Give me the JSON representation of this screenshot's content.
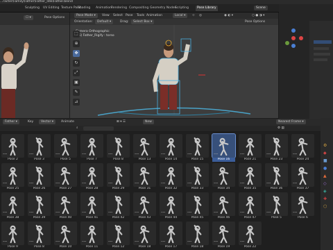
{
  "title": "...racter\\Family\\Father\\Father_Idle\\Father.blend",
  "menu_tabs": [
    {
      "label": "Sculpting",
      "active": false
    },
    {
      "label": "UV Editing",
      "active": false
    },
    {
      "label": "Texture Paint",
      "active": false
    },
    {
      "label": "Shading",
      "active": false
    },
    {
      "label": "Animation",
      "active": false
    },
    {
      "label": "Rendering",
      "active": false
    },
    {
      "label": "Compositing",
      "active": false
    },
    {
      "label": "Geometry Nodes",
      "active": false
    },
    {
      "label": "Scripting",
      "active": false
    },
    {
      "label": "Pose Library",
      "active": true
    }
  ],
  "topright": {
    "scene_label": "Scene",
    "layer_label": "Default"
  },
  "left_view": {
    "pose_options": "Pose Options"
  },
  "viewport": {
    "mode": "Pose Mode",
    "menus": [
      "View",
      "Select",
      "Pose",
      "Tools",
      "Animation"
    ],
    "orientation_label": "Orientation:",
    "orientation_value": "Default",
    "drag_label": "Drag:",
    "drag_value": "Select Box",
    "transform": "Local",
    "pose_options": "Pose Options",
    "camera_line1": "Camera Orthographic",
    "camera_line2": "(15) Father_Rigify : torso"
  },
  "asset_browser": {
    "library": "Father",
    "key_label": "Key",
    "mode": "Vector",
    "anim_label": "Animate",
    "new_label": "New",
    "nearest_frame": "Nearest Frame",
    "tabs": [
      "Select",
      "Mesh",
      "View",
      "Select"
    ]
  },
  "poses": [
    {
      "label": "Pose 2",
      "sel": false
    },
    {
      "label": "Pose 3",
      "sel": false
    },
    {
      "label": "Pose 5",
      "sel": false
    },
    {
      "label": "Pose 7",
      "sel": false
    },
    {
      "label": "Pose 8",
      "sel": false
    },
    {
      "label": "Pose 13",
      "sel": false
    },
    {
      "label": "Pose 14",
      "sel": false
    },
    {
      "label": "Pose 15",
      "sel": false
    },
    {
      "label": "Pose 16",
      "sel": true
    },
    {
      "label": "Pose 21",
      "sel": false
    },
    {
      "label": "Pose 23",
      "sel": false
    },
    {
      "label": "Pose 24",
      "sel": false
    },
    {
      "label": "Pose 25",
      "sel": false
    },
    {
      "label": "Pose 26",
      "sel": false
    },
    {
      "label": "Pose 27",
      "sel": false
    },
    {
      "label": "Pose 28",
      "sel": false
    },
    {
      "label": "Pose 29",
      "sel": false
    },
    {
      "label": "Pose 31",
      "sel": false
    },
    {
      "label": "Pose 32",
      "sel": false
    },
    {
      "label": "Pose 33",
      "sel": false
    },
    {
      "label": "Pose 34",
      "sel": false
    },
    {
      "label": "Pose 35",
      "sel": false
    },
    {
      "label": "Pose 36",
      "sel": false
    },
    {
      "label": "Pose 37",
      "sel": false
    },
    {
      "label": "Pose 38",
      "sel": false
    },
    {
      "label": "Pose 39",
      "sel": false
    },
    {
      "label": "Pose 40",
      "sel": false
    },
    {
      "label": "Pose 41",
      "sel": false
    },
    {
      "label": "Pose 42",
      "sel": false
    },
    {
      "label": "Pose 43",
      "sel": false
    },
    {
      "label": "Pose 44",
      "sel": false
    },
    {
      "label": "Pose 45",
      "sel": false
    },
    {
      "label": "Pose 46",
      "sel": false
    },
    {
      "label": "Pose 47",
      "sel": false
    },
    {
      "label": "Pose 5",
      "sel": false
    },
    {
      "label": "Pose 6",
      "sel": false
    },
    {
      "label": "Pose 9",
      "sel": false
    },
    {
      "label": "Pose 8",
      "sel": false
    },
    {
      "label": "Pose 10",
      "sel": false
    },
    {
      "label": "Pose 11",
      "sel": false
    },
    {
      "label": "Pose 12",
      "sel": false
    },
    {
      "label": "Pose 18",
      "sel": false
    },
    {
      "label": "Pose 17",
      "sel": false
    },
    {
      "label": "Pose 18",
      "sel": false
    },
    {
      "label": "Pose 19",
      "sel": false
    },
    {
      "label": "Pose 22",
      "sel": false
    }
  ],
  "colors": {
    "accent": "#4a7fd4",
    "selected_card": "#3b5d99",
    "viewport_bg": "#3d3d3d"
  }
}
